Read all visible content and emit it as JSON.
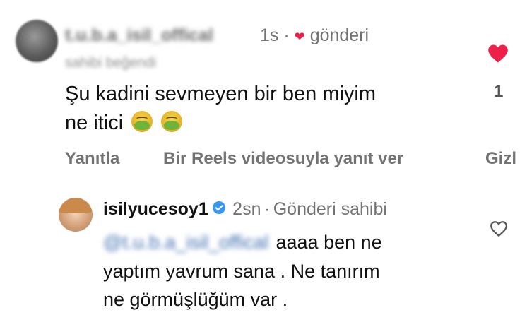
{
  "comment": {
    "username": "t.u.b.a_isil_offical",
    "time": "1s",
    "separator": "·",
    "owner_like_label": "gönderi",
    "liked_by": "sahibi beğendi",
    "text_line1": "Şu kadini sevmeyen bir ben miyim",
    "text_line2": "ne itici",
    "like_count": "1",
    "actions": {
      "reply": "Yanıtla",
      "reels_reply": "Bir Reels videosuyla yanıt ver",
      "hide": "Gizl"
    },
    "heart_color": "#ed2049"
  },
  "reply": {
    "username": "isilyucesoy1",
    "verified": true,
    "time": "2sn",
    "separator": "·",
    "owner_label": "Gönderi sahibi",
    "mention": "@t.u.b.a_isil_offical",
    "text_line1": "aaaa ben ne",
    "text_line2": "yaptım yavrum sana . Ne tanırım",
    "text_line3": "ne görmüşlüğüm var ."
  },
  "icons": {
    "liked": "heart-filled-icon",
    "like": "heart-outline-icon",
    "verified": "verified-badge-icon",
    "emoji": "nauseated-face-emoji"
  }
}
